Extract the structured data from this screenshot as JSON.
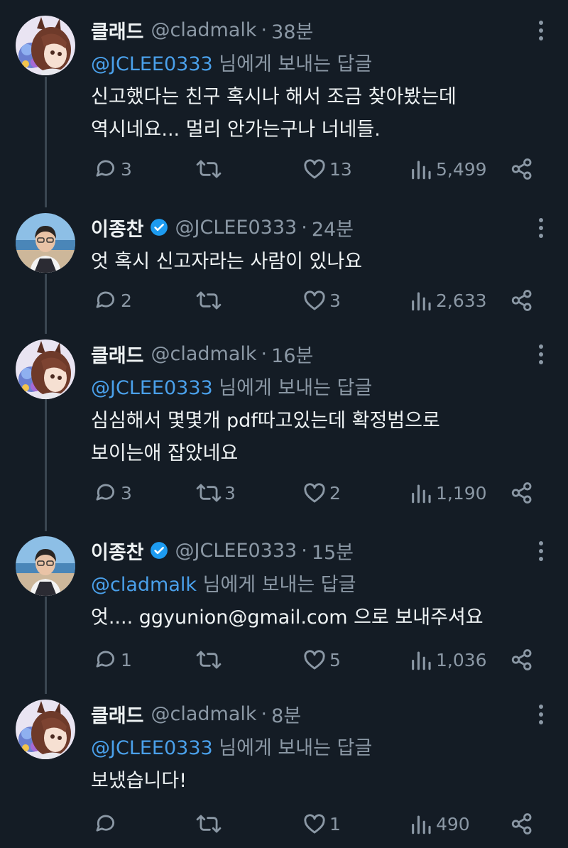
{
  "thread": [
    {
      "author": "클래드",
      "handle": "@cladmalk",
      "sep": "·",
      "time": "38분",
      "verified": false,
      "avatar": "anime-girl-avatar",
      "reply_to": {
        "mention": "@JCLEE0333",
        "suffix": " 님에게 보내는 답글"
      },
      "text_lines": [
        "신고했다는 친구 혹시나 해서 조금 찾아봤는데",
        "역시네요... 멀리 안가는구나 너네들."
      ],
      "stats": {
        "replies": "3",
        "retweets": "",
        "likes": "13",
        "views": "5,499"
      }
    },
    {
      "author": "이종찬",
      "handle": "@JCLEE0333",
      "sep": "·",
      "time": "24분",
      "verified": true,
      "avatar": "man-photo-avatar",
      "reply_to": null,
      "text_lines": [
        "엇 혹시 신고자라는 사람이 있나요"
      ],
      "stats": {
        "replies": "2",
        "retweets": "",
        "likes": "3",
        "views": "2,633"
      }
    },
    {
      "author": "클래드",
      "handle": "@cladmalk",
      "sep": "·",
      "time": "16분",
      "verified": false,
      "avatar": "anime-girl-avatar",
      "reply_to": {
        "mention": "@JCLEE0333",
        "suffix": " 님에게 보내는 답글"
      },
      "text_lines": [
        "심심해서 몇몇개 pdf따고있는데 확정범으로",
        "보이는애 잡았네요"
      ],
      "stats": {
        "replies": "3",
        "retweets": "3",
        "likes": "2",
        "views": "1,190"
      }
    },
    {
      "author": "이종찬",
      "handle": "@JCLEE0333",
      "sep": "·",
      "time": "15분",
      "verified": true,
      "avatar": "man-photo-avatar",
      "reply_to": {
        "mention": "@cladmalk",
        "suffix": " 님에게 보내는 답글"
      },
      "text_lines": [
        "엇.... ggyunion@gmail.com 으로 보내주셔요"
      ],
      "stats": {
        "replies": "1",
        "retweets": "",
        "likes": "5",
        "views": "1,036"
      }
    },
    {
      "author": "클래드",
      "handle": "@cladmalk",
      "sep": "·",
      "time": "8분",
      "verified": false,
      "avatar": "anime-girl-avatar",
      "reply_to": {
        "mention": "@JCLEE0333",
        "suffix": " 님에게 보내는 답글"
      },
      "text_lines": [
        "보냈습니다!"
      ],
      "stats": {
        "replies": "",
        "retweets": "",
        "likes": "1",
        "views": "490"
      }
    }
  ],
  "colors": {
    "background": "#141c25",
    "text": "#eff3f4",
    "muted": "#8b98a5",
    "mention": "#4aa0ea",
    "verified": "#1d9bf0",
    "thread_line": "#3a4651"
  }
}
